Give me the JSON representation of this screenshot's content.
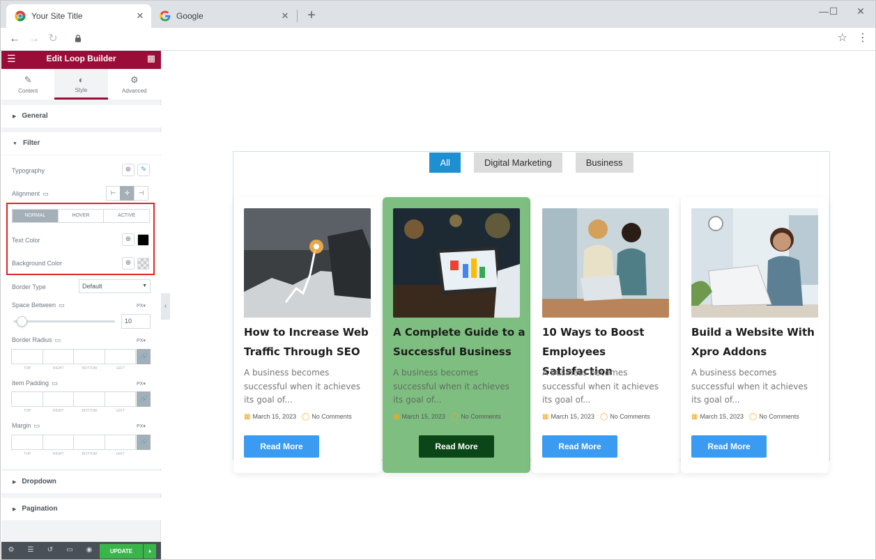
{
  "browser": {
    "tabs": [
      {
        "title": "Your Site Title",
        "close": "✕"
      },
      {
        "title": "Google",
        "close": "✕"
      }
    ],
    "new_tab": "+",
    "window_controls": {
      "minimize": "—",
      "maximize": "☐",
      "close": "✕"
    },
    "nav": {
      "back": "←",
      "forward": "→",
      "reload": "↻"
    },
    "bookmark": "☆",
    "menu": "⋮"
  },
  "panel": {
    "title": "Edit Loop Builder",
    "tabs": [
      {
        "label": "Content",
        "icon": "✎"
      },
      {
        "label": "Style",
        "icon": "◐"
      },
      {
        "label": "Advanced",
        "icon": "⚙"
      }
    ],
    "sections": {
      "general": "General",
      "filter": "Filter",
      "dropdown": "Dropdown",
      "pagination": "Pagination"
    },
    "filter": {
      "typography_label": "Typography",
      "alignment_label": "Alignment",
      "state_tabs": [
        "NORMAL",
        "HOVER",
        "ACTIVE"
      ],
      "text_color_label": "Text Color",
      "text_color": "#000000",
      "background_color_label": "Background Color",
      "border_type_label": "Border Type",
      "border_type_value": "Default",
      "space_between_label": "Space Between",
      "space_between_value": "10",
      "unit": "PX",
      "border_radius_label": "Border Radius",
      "item_padding_label": "Item Padding",
      "margin_label": "Margin",
      "dim_labels": [
        "TOP",
        "RIGHT",
        "BOTTOM",
        "LEFT"
      ]
    },
    "footer": {
      "update_label": "UPDATE"
    },
    "accent": "#9a0d38",
    "highlight": "#e02424"
  },
  "preview": {
    "filters": [
      "All",
      "Digital Marketing",
      "Business"
    ],
    "cards": [
      {
        "title": "How to Increase Web Traffic Through SEO",
        "excerpt": "A business becomes successful when it achieves its goal of...",
        "date": "March 15, 2023",
        "comments": "No Comments",
        "button": "Read More"
      },
      {
        "title": "A Complete Guide to a Successful Business",
        "excerpt": "A business becomes successful when it achieves its goal of...",
        "date": "March 15, 2023",
        "comments": "No Comments",
        "button": "Read More"
      },
      {
        "title": "10 Ways to Boost Employees Satisfaction",
        "excerpt": "A business becomes successful when it achieves its goal of...",
        "date": "March 15, 2023",
        "comments": "No Comments",
        "button": "Read More"
      },
      {
        "title": "Build a Website With Xpro Addons",
        "excerpt": "A business becomes successful when it achieves its goal of...",
        "date": "March 15, 2023",
        "comments": "No Comments",
        "button": "Read More"
      }
    ],
    "active_filter_color": "#1e8fd0",
    "highlight_card_color": "#7ebf81",
    "button_color": "#3a9bf0"
  }
}
